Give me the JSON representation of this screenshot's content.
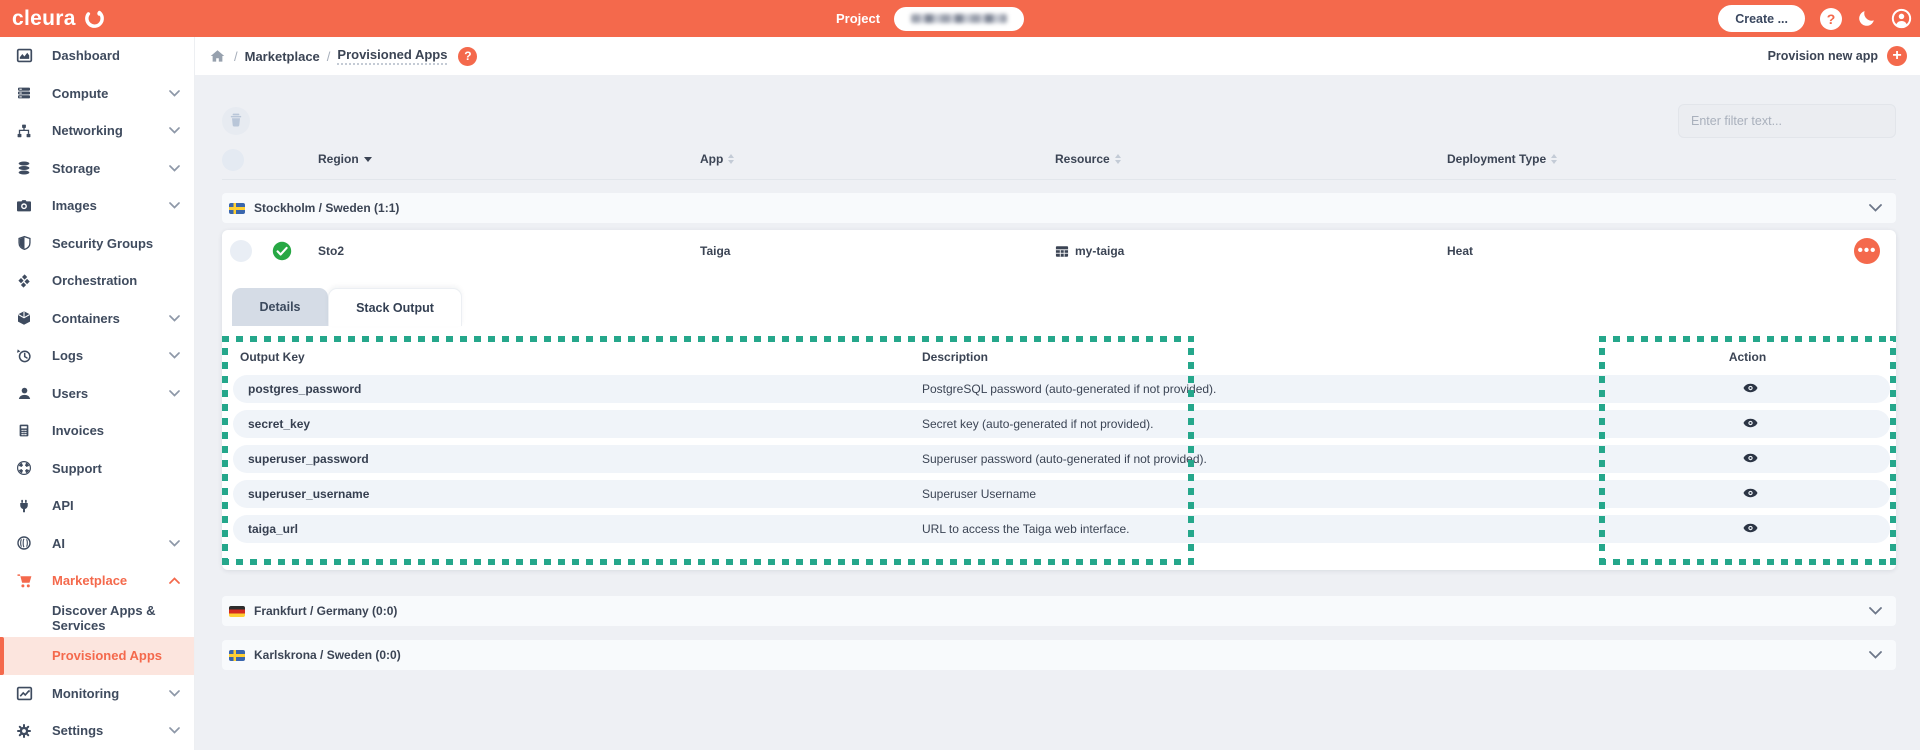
{
  "topbar": {
    "logo_text": "cleura",
    "project_label": "Project",
    "create_button": "Create ..."
  },
  "icons": {
    "help": "?",
    "add": "+",
    "ellipsis": "•••"
  },
  "sidebar": {
    "items": [
      {
        "label": "Dashboard",
        "icon": "dashboard"
      },
      {
        "label": "Compute",
        "icon": "compute",
        "chevron": "down"
      },
      {
        "label": "Networking",
        "icon": "networking",
        "chevron": "down"
      },
      {
        "label": "Storage",
        "icon": "storage",
        "chevron": "down"
      },
      {
        "label": "Images",
        "icon": "images",
        "chevron": "down"
      },
      {
        "label": "Security Groups",
        "icon": "security-groups"
      },
      {
        "label": "Orchestration",
        "icon": "orchestration"
      },
      {
        "label": "Containers",
        "icon": "containers",
        "chevron": "down"
      },
      {
        "label": "Logs",
        "icon": "logs",
        "chevron": "down"
      },
      {
        "label": "Users",
        "icon": "users",
        "chevron": "down"
      },
      {
        "label": "Invoices",
        "icon": "invoices"
      },
      {
        "label": "Support",
        "icon": "support"
      },
      {
        "label": "API",
        "icon": "api"
      },
      {
        "label": "AI",
        "icon": "ai",
        "chevron": "down"
      },
      {
        "label": "Marketplace",
        "icon": "marketplace",
        "chevron": "up",
        "state": "expanded"
      },
      {
        "label": "Discover Apps & Services",
        "child": true
      },
      {
        "label": "Provisioned Apps",
        "child": true,
        "state": "active"
      },
      {
        "label": "Monitoring",
        "icon": "monitoring",
        "chevron": "down"
      },
      {
        "label": "Settings",
        "icon": "settings",
        "chevron": "down"
      }
    ]
  },
  "breadcrumb": {
    "items": [
      "Marketplace",
      "Provisioned Apps"
    ]
  },
  "page_actions": {
    "provision_new_app": "Provision new app"
  },
  "filter": {
    "placeholder": "Enter filter text..."
  },
  "apps_table": {
    "columns": [
      "Region",
      "App",
      "Resource",
      "Deployment Type"
    ],
    "groups": [
      {
        "label": "Stockholm / Sweden (1:1)",
        "flag": "sweden",
        "expanded": true
      },
      {
        "label": "Frankfurt / Germany (0:0)",
        "flag": "germany",
        "expanded": false
      },
      {
        "label": "Karlskrona / Sweden (0:0)",
        "flag": "sweden",
        "expanded": false
      }
    ],
    "row": {
      "region": "Sto2",
      "app": "Taiga",
      "resource": "my-taiga",
      "deployment_type": "Heat",
      "status": "success"
    }
  },
  "detail_panel": {
    "tabs": [
      {
        "label": "Details",
        "active": false
      },
      {
        "label": "Stack Output",
        "active": true
      }
    ],
    "output_table": {
      "headers": {
        "key": "Output Key",
        "description": "Description",
        "action": "Action"
      },
      "rows": [
        {
          "key": "postgres_password",
          "description": "PostgreSQL password (auto-generated if not provided)."
        },
        {
          "key": "secret_key",
          "description": "Secret key (auto-generated if not provided)."
        },
        {
          "key": "superuser_password",
          "description": "Superuser password (auto-generated if not provided)."
        },
        {
          "key": "superuser_username",
          "description": "Superuser Username"
        },
        {
          "key": "taiga_url",
          "description": "URL to access the Taiga web interface."
        }
      ]
    }
  },
  "colors": {
    "accent": "#f4694c",
    "selection_dash": "#25a78b",
    "success": "#27a844"
  }
}
